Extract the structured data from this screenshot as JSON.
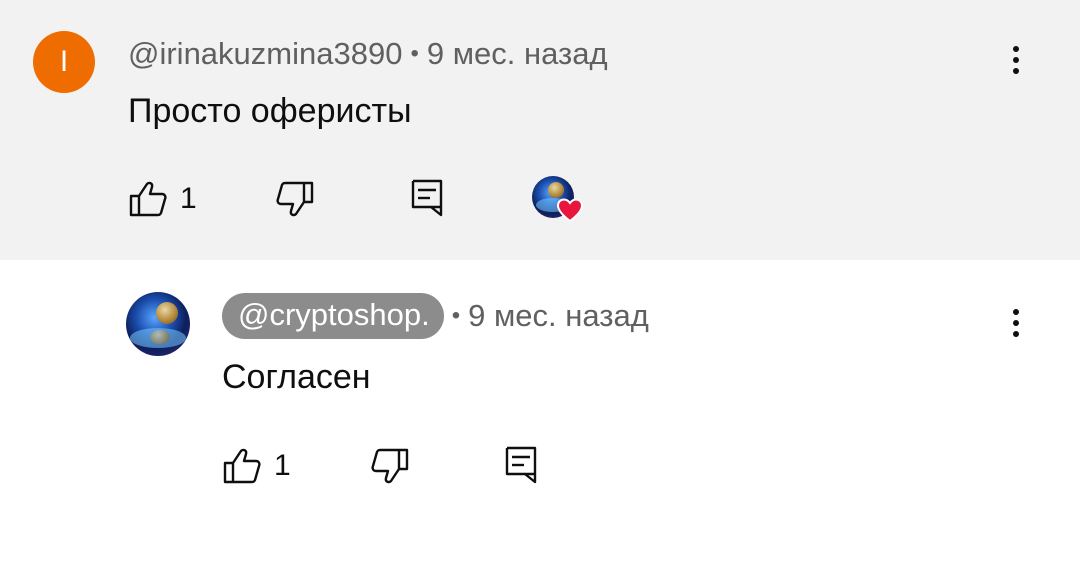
{
  "comments": [
    {
      "author": "@irinakuzmina3890",
      "time": "9 мес. назад",
      "avatar_letter": "I",
      "text": "Просто оферисты",
      "likes": "1"
    },
    {
      "author": "@cryptoshop.",
      "time": "9 мес. назад",
      "text": "Согласен",
      "likes": "1"
    }
  ],
  "separator": "•",
  "colors": {
    "top_background": "#f2f2f2",
    "avatar_orange": "#ef6c00",
    "author_pill": "#8c8c8c",
    "heart": "#e8153d"
  },
  "icons": {
    "like": "thumb-up-icon",
    "dislike": "thumb-down-icon",
    "reply": "reply-comment-icon",
    "menu": "more-vertical-icon",
    "heart": "heart-icon"
  }
}
